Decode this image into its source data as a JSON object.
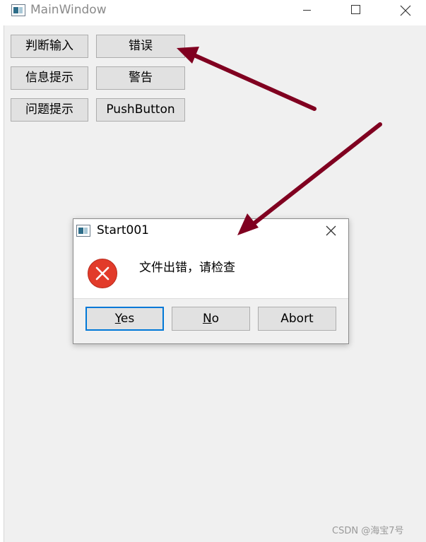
{
  "main_window": {
    "title": "MainWindow",
    "buttons": {
      "judge_input": "判断输入",
      "error": "错误",
      "info": "信息提示",
      "warning": "警告",
      "question": "问题提示",
      "push": "PushButton"
    }
  },
  "dialog": {
    "title": "Start001",
    "message": "文件出错，请检查",
    "icon": "error-icon",
    "buttons": {
      "yes_mnemonic": "Y",
      "yes_rest": "es",
      "no_mnemonic": "N",
      "no_rest": "o",
      "abort": "Abort"
    }
  },
  "annotation": {
    "arrow_color": "#800020"
  },
  "watermark": "CSDN @海宝7号"
}
